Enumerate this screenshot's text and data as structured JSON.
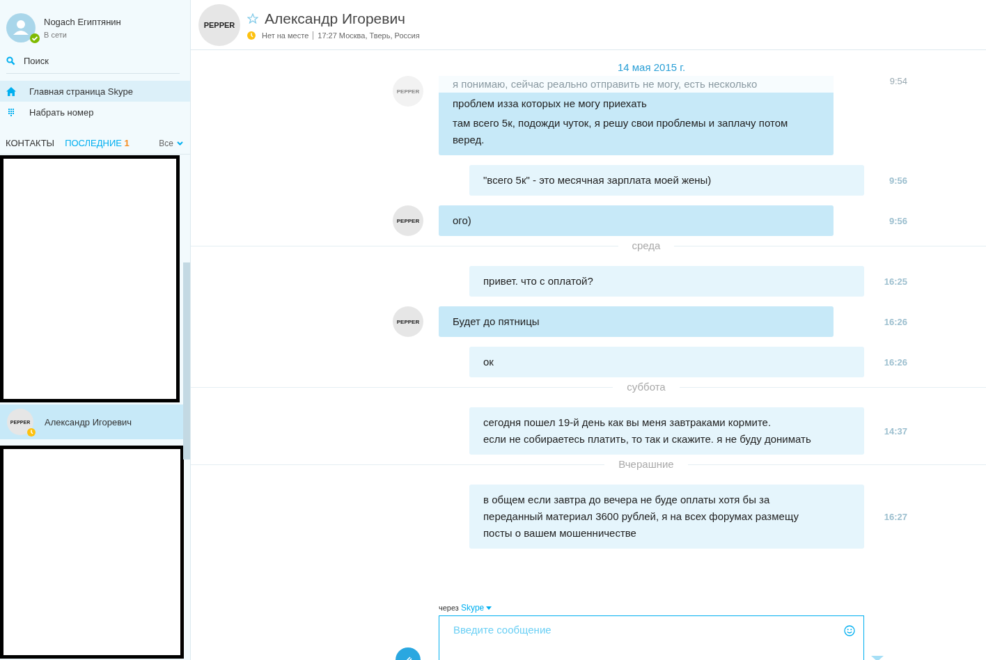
{
  "sidebar": {
    "profile": {
      "name": "Nogach Египтянин",
      "status": "В сети"
    },
    "search": {
      "label": "Поиск"
    },
    "nav": [
      {
        "kind": "home",
        "label": "Главная страница Skype",
        "selected": true
      },
      {
        "kind": "dial",
        "label": "Набрать номер",
        "selected": false
      }
    ],
    "tabs": [
      {
        "label": "КОНТАКТЫ",
        "selected": false
      },
      {
        "label": "ПОСЛЕДНИЕ",
        "badge": "1",
        "selected": true
      }
    ],
    "filter": "Все",
    "contacts": [
      {
        "kind": "redacted"
      },
      {
        "kind": "contact",
        "name": "Александр Игоревич",
        "avatar": "PEPPER",
        "selected": true
      },
      {
        "kind": "redacted"
      }
    ]
  },
  "header": {
    "name": "Александр Игоревич",
    "avatar": "PEPPER",
    "presence": "Нет на месте",
    "location": "17:27 Москва, Тверь, Россия"
  },
  "conversation": [
    {
      "date": "14 мая 2015 г.",
      "kind": "sticky",
      "messages": [
        {
          "kind": "incoming",
          "avatar": "PEPPER",
          "time": "9:54",
          "time_faded": true,
          "paragraphs": [
            {
              "text": "я понимаю, сейчас реально отправить не могу, есть несколько",
              "faded": true
            },
            {
              "text": "проблем изза которых не могу приехать",
              "faded": false
            },
            {
              "text": "там всего 5к, подожди чуток, я решу свои проблемы и заплачу потом веред.",
              "faded": false
            }
          ]
        },
        {
          "kind": "outgoing",
          "time": "9:56",
          "time_faded": false,
          "paragraphs": [
            {
              "text": "\"всего 5к\" - это месячная зарплата моей жены)",
              "faded": false
            }
          ]
        },
        {
          "kind": "incoming",
          "avatar": "PEPPER",
          "time": "9:56",
          "time_faded": false,
          "paragraphs": [
            {
              "text": "ого)",
              "faded": false
            }
          ]
        }
      ]
    },
    {
      "date": "среда",
      "kind": "divider",
      "messages": [
        {
          "kind": "outgoing",
          "time": "16:25",
          "time_faded": false,
          "paragraphs": [
            {
              "text": "привет. что с оплатой?",
              "faded": false
            }
          ]
        },
        {
          "kind": "incoming",
          "avatar": "PEPPER",
          "time": "16:26",
          "time_faded": false,
          "paragraphs": [
            {
              "text": "Будет до пятницы",
              "faded": false
            }
          ]
        },
        {
          "kind": "outgoing",
          "time": "16:26",
          "time_faded": false,
          "paragraphs": [
            {
              "text": "ок",
              "faded": false
            }
          ]
        }
      ]
    },
    {
      "date": "суббота",
      "kind": "divider",
      "messages": [
        {
          "kind": "outgoing",
          "time": "14:37",
          "time_faded": false,
          "paragraphs": [
            {
              "text": "сегодня пошел 19-й день как вы меня завтраками кормите.\nесли не собираетесь платить, то так и скажите. я не буду донимать",
              "faded": false
            }
          ]
        }
      ]
    },
    {
      "date": "Вчерашние",
      "kind": "divider",
      "messages": [
        {
          "kind": "outgoing",
          "time": "16:27",
          "time_faded": false,
          "paragraphs": [
            {
              "text": "в общем если завтра до вечера не буде оплаты хотя бы за\nпереданный материал 3600 рублей, я на всех форумах размещу\nпосты о вашем мошенничестве",
              "faded": false
            }
          ]
        }
      ]
    }
  ],
  "composer": {
    "via": "через",
    "service": "Skype",
    "placeholder": "Введите сообщение"
  }
}
